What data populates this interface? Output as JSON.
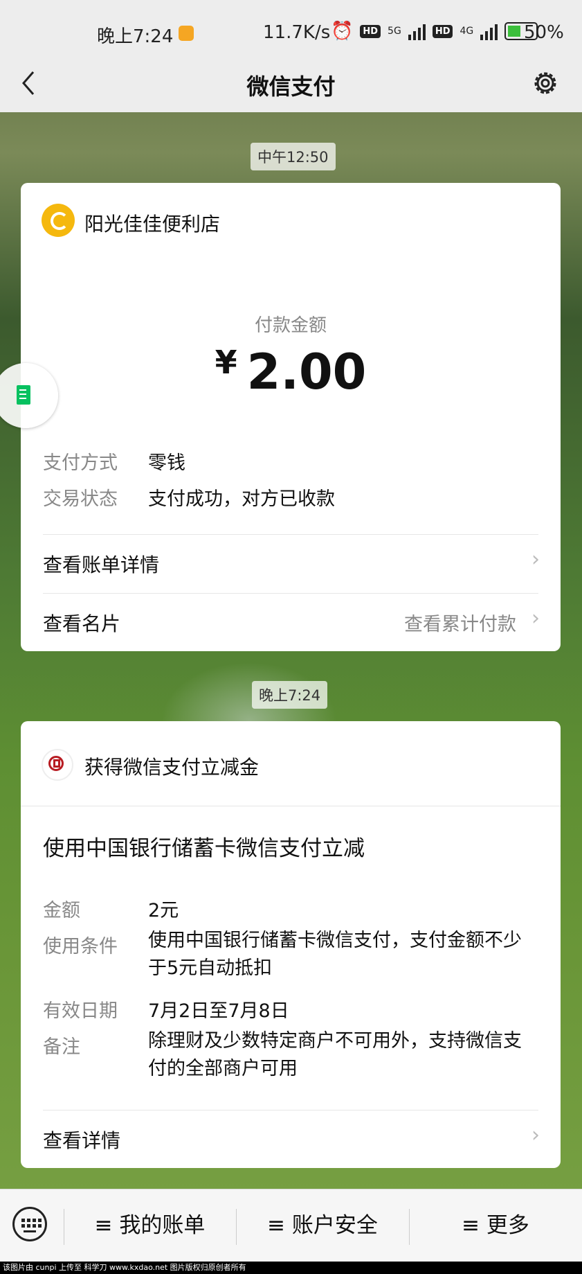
{
  "status_bar": {
    "time": "晚上7:24",
    "network_speed": "11.7K/s",
    "hd1": "HD",
    "net1": "5G",
    "hd2": "HD",
    "net2": "4G",
    "battery": "50%"
  },
  "nav": {
    "title": "微信支付"
  },
  "message1": {
    "time": "中午12:50",
    "merchant": "阳光佳佳便利店",
    "amount_label": "付款金额",
    "currency": "¥",
    "amount": "2.00",
    "rows": [
      {
        "label": "支付方式",
        "value": "零钱"
      },
      {
        "label": "交易状态",
        "value": "支付成功，对方已收款"
      }
    ],
    "link_bill": "查看账单详情",
    "link_card": "查看名片",
    "link_card_right": "查看累计付款"
  },
  "message2": {
    "time": "晚上7:24",
    "header": "获得微信支付立减金",
    "title": "使用中国银行储蓄卡微信支付立减",
    "rows": [
      {
        "label": "金额",
        "value": "2元"
      },
      {
        "label": "使用条件",
        "value": "使用中国银行储蓄卡微信支付，支付金额不少于5元自动抵扣"
      },
      {
        "label": "有效日期",
        "value": "7月2日至7月8日"
      },
      {
        "label": "备注",
        "value": "除理财及少数特定商户不可用外，支持微信支付的全部商户可用"
      }
    ],
    "link_details": "查看详情"
  },
  "bottom_bar": {
    "tabs": [
      {
        "label": "≡ 我的账单"
      },
      {
        "label": "≡ 账户安全"
      },
      {
        "label": "≡ 更多"
      }
    ]
  },
  "watermark": "该图片由 cunpi 上传至 科学刀 www.kxdao.net 图片版权归原创者所有",
  "colors": {
    "wechat_green": "#07c160",
    "merchant_logo": "#f5b80e",
    "boc_red": "#b81c22"
  }
}
